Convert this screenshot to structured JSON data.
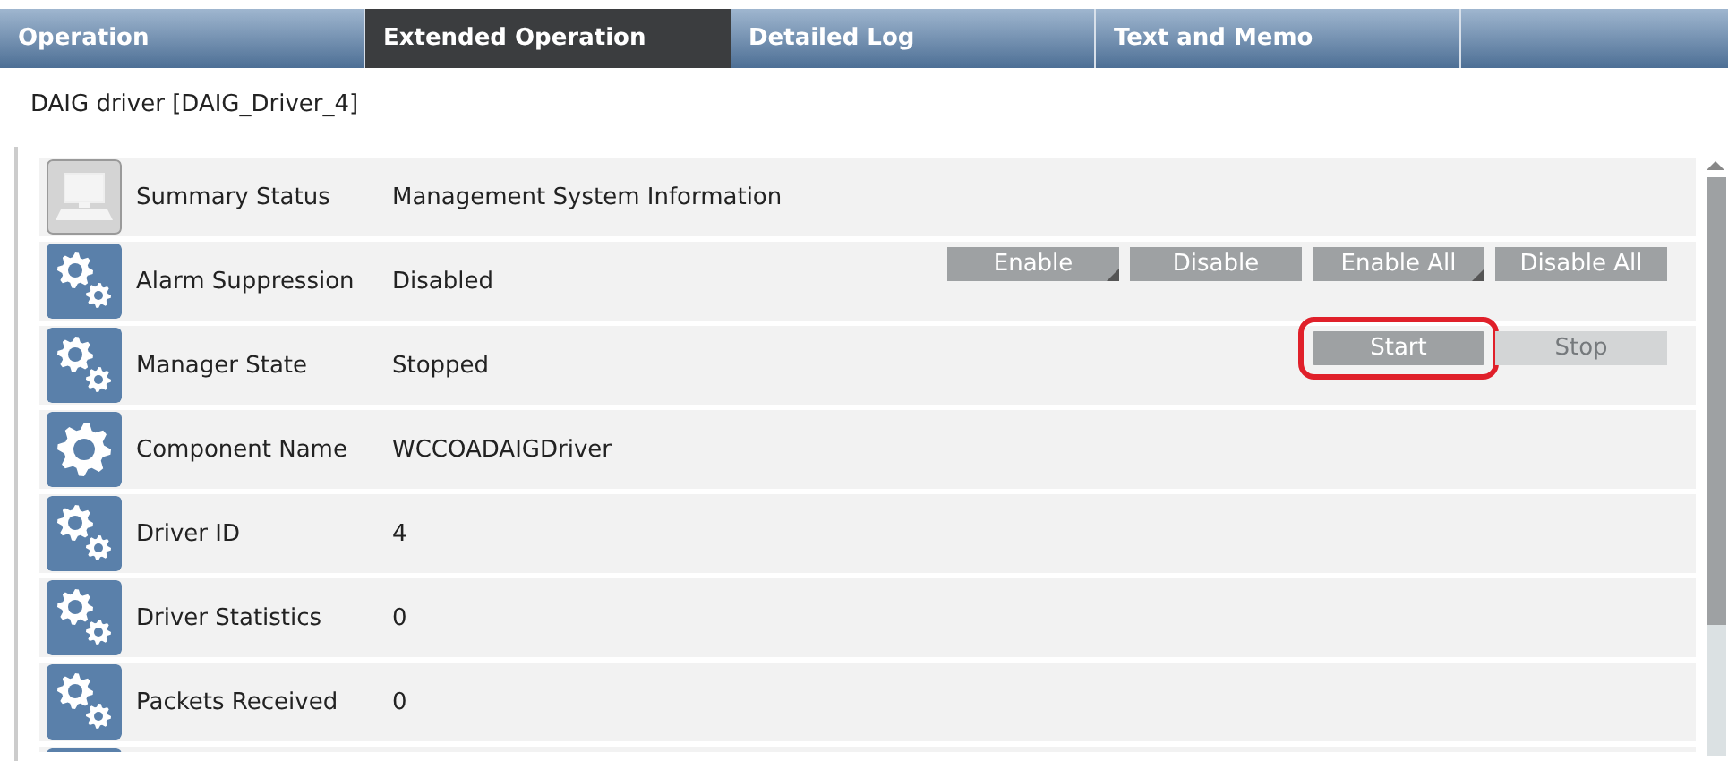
{
  "tabs": [
    {
      "label": "Operation",
      "selected": false
    },
    {
      "label": "Extended Operation",
      "selected": true
    },
    {
      "label": "Detailed Log",
      "selected": false
    },
    {
      "label": "Text and Memo",
      "selected": false
    }
  ],
  "title": "DAIG driver [DAIG_Driver_4]",
  "rows": [
    {
      "kind": "computer",
      "label": "Summary Status",
      "value": "Management System Information",
      "buttons": []
    },
    {
      "kind": "gears",
      "label": "Alarm Suppression",
      "value": "Disabled",
      "buttons": [
        {
          "label": "Enable",
          "kind": "menu",
          "disabled": false,
          "highlighted": false
        },
        {
          "label": "Disable",
          "kind": "plain",
          "disabled": false,
          "highlighted": false
        },
        {
          "label": "Enable All",
          "kind": "menu",
          "disabled": false,
          "highlighted": false
        },
        {
          "label": "Disable All",
          "kind": "plain",
          "disabled": false,
          "highlighted": false
        }
      ]
    },
    {
      "kind": "gears",
      "label": "Manager State",
      "value": "Stopped",
      "buttons": [
        {
          "label": "Start",
          "kind": "plain",
          "disabled": false,
          "highlighted": true
        },
        {
          "label": "Stop",
          "kind": "plain",
          "disabled": true,
          "highlighted": false
        }
      ]
    },
    {
      "kind": "gear",
      "label": "Component Name",
      "value": "WCCOADAIGDriver",
      "buttons": []
    },
    {
      "kind": "gears",
      "label": "Driver ID",
      "value": "4",
      "buttons": []
    },
    {
      "kind": "gears",
      "label": "Driver Statistics",
      "value": "0",
      "buttons": []
    },
    {
      "kind": "gears",
      "label": "Packets Received",
      "value": "0",
      "buttons": []
    },
    {
      "kind": "gears",
      "buttons": []
    }
  ]
}
